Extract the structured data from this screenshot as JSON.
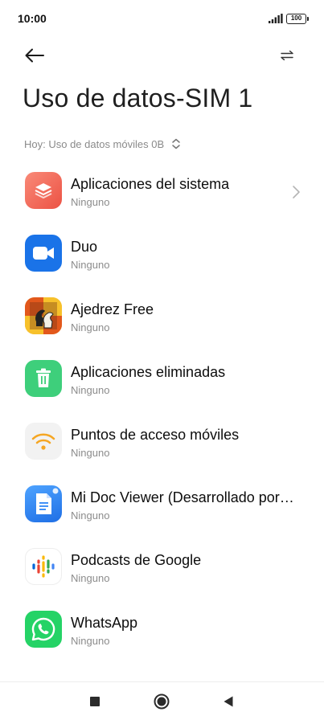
{
  "status_bar": {
    "time": "10:00",
    "battery": "100",
    "icons": [
      "signal-icon",
      "battery-icon"
    ]
  },
  "header": {
    "back_icon": "arrow-left-icon",
    "swap_icon": "swap-arrows-icon",
    "title": "Uso de datos-SIM 1"
  },
  "filter": {
    "label": "Hoy: Uso de datos móviles 0B",
    "icon": "updown-chevron-icon"
  },
  "apps": [
    {
      "name": "Aplicaciones del sistema",
      "usage": "Ninguno",
      "icon": "system-apps-icon",
      "color": "#f0675a",
      "has_chevron": true
    },
    {
      "name": "Duo",
      "usage": "Ninguno",
      "icon": "duo-icon",
      "color": "#1a73e8"
    },
    {
      "name": "Ajedrez Free",
      "usage": "Ninguno",
      "icon": "chess-icon",
      "color": "#e0711c"
    },
    {
      "name": "Aplicaciones eliminadas",
      "usage": "Ninguno",
      "icon": "trash-icon",
      "color": "#3ecf7b"
    },
    {
      "name": "Puntos de acceso móviles",
      "usage": "Ninguno",
      "icon": "hotspot-icon",
      "color": "#f5a623"
    },
    {
      "name": "Mi Doc Viewer (Desarrollado por…",
      "usage": "Ninguno",
      "icon": "doc-viewer-icon",
      "color": "#2f86f6"
    },
    {
      "name": "Podcasts de Google",
      "usage": "Ninguno",
      "icon": "google-podcasts-icon",
      "color": "#ffffff"
    },
    {
      "name": "WhatsApp",
      "usage": "Ninguno",
      "icon": "whatsapp-icon",
      "color": "#25d366"
    }
  ],
  "nav_bar": {
    "icons": [
      "recents-square-icon",
      "home-circle-icon",
      "back-triangle-icon"
    ]
  }
}
